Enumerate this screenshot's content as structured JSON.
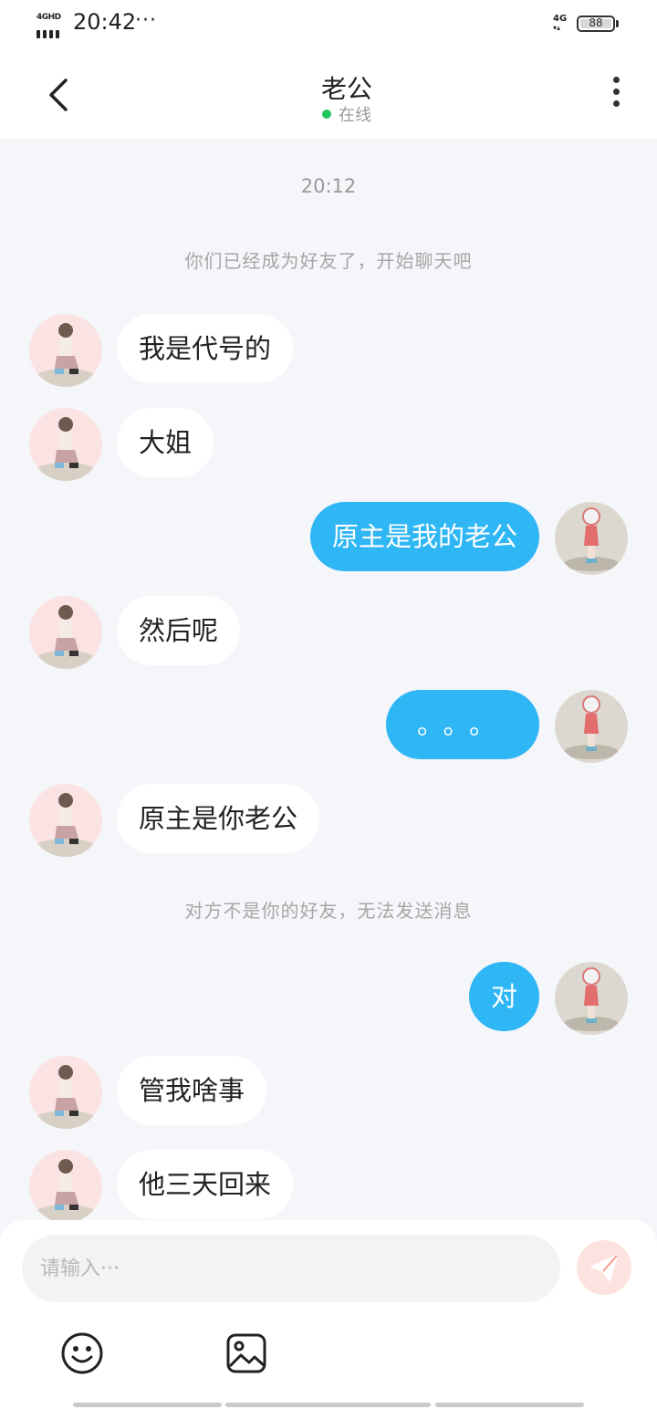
{
  "status_bar": {
    "network": "4GHD",
    "time": "20:42",
    "more": "···",
    "signal_label": "4G",
    "battery": "88"
  },
  "header": {
    "title": "老公",
    "status": "在线",
    "back_icon": "chevron-left-icon",
    "more_icon": "vertical-dots-icon"
  },
  "chat": {
    "time": "20:12",
    "system_messages": [
      "你们已经成为好友了，开始聊天吧",
      "对方不是你的好友，无法发送消息"
    ],
    "messages": [
      {
        "side": "in",
        "text": "我是代号的"
      },
      {
        "side": "in",
        "text": "大姐"
      },
      {
        "side": "out",
        "text": "原主是我的老公"
      },
      {
        "side": "in",
        "text": "然后呢"
      },
      {
        "side": "out",
        "text": "。。。"
      },
      {
        "side": "in",
        "text": "原主是你老公"
      },
      {
        "side": "out",
        "text": "对"
      },
      {
        "side": "in",
        "text": "管我啥事"
      },
      {
        "side": "in",
        "text": "他三天回来"
      }
    ]
  },
  "composer": {
    "placeholder": "请输入···",
    "send_icon": "paper-plane-icon",
    "emoji_icon": "smiley-icon",
    "image_icon": "image-icon"
  },
  "colors": {
    "accent": "#2fb6f5",
    "online": "#22c55e",
    "background": "#f4f6f9",
    "send_button": "#f8988c"
  }
}
